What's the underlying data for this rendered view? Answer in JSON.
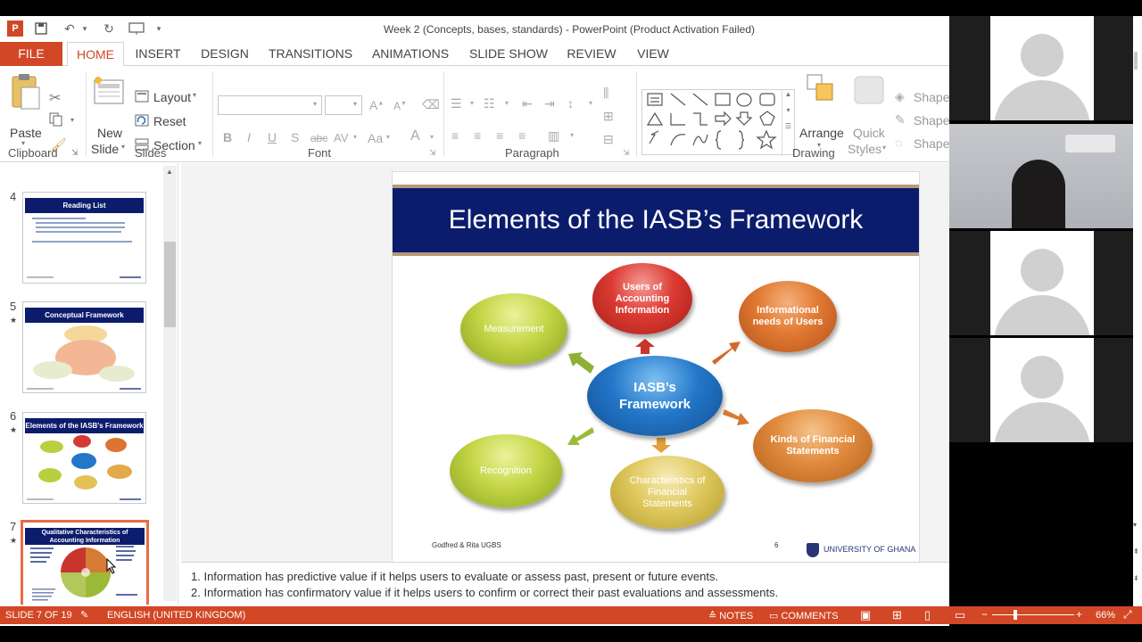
{
  "titlebar": {
    "title": "Week 2 (Concepts, bases, standards) - PowerPoint (Product Activation Failed)"
  },
  "tabs": [
    "FILE",
    "HOME",
    "INSERT",
    "DESIGN",
    "TRANSITIONS",
    "ANIMATIONS",
    "SLIDE SHOW",
    "REVIEW",
    "VIEW"
  ],
  "ribbon": {
    "clipboard": {
      "paste": "Paste",
      "label": "Clipboard"
    },
    "slides": {
      "new_slide_1": "New",
      "new_slide_2": "Slide",
      "layout": "Layout",
      "reset": "Reset",
      "section": "Section",
      "label": "Slides"
    },
    "font": {
      "label": "Font",
      "bold": "B",
      "italic": "I",
      "underline": "U",
      "shadow": "S",
      "strike": "abc",
      "spacing": "AV",
      "case": "Aa",
      "color": "A"
    },
    "paragraph": {
      "label": "Paragraph"
    },
    "drawing": {
      "label": "Drawing",
      "arrange": "Arrange",
      "quick_styles_1": "Quick",
      "quick_styles_2": "Styles",
      "shape_fill": "Shape",
      "shape_outline": "Shape",
      "shape_effects": "Shape"
    }
  },
  "thumbnails": [
    {
      "num": "4",
      "title": "Reading List",
      "star": ""
    },
    {
      "num": "5",
      "title": "Conceptual Framework",
      "star": "★"
    },
    {
      "num": "6",
      "title": "Elements of the IASB's Framework",
      "star": "★"
    },
    {
      "num": "7",
      "title": "Qualitative Characteristics of Accounting Information",
      "star": "★"
    }
  ],
  "slide": {
    "title": "Elements of the IASB’s Framework",
    "center": "IASB’s Framework",
    "nodes": {
      "users": "Users of Accounting Information",
      "needs": "Informational needs of Users",
      "measurement": "Measurement",
      "kinds": "Kinds of Financial Statements",
      "recognition": "Recognition",
      "characteristics": "Characteristics of Financial Statements"
    },
    "footer_left": "Godfred & Rita UGBS",
    "page_number": "6",
    "footer_right": "UNIVERSITY OF GHANA"
  },
  "notes": {
    "line1": "1.   Information has predictive value if it helps users to evaluate or assess past, present or future events.",
    "line2": "2.   Information has confirmatory value if it helps users to confirm or correct their past evaluations and assessments."
  },
  "status": {
    "slide": "SLIDE 7 OF 19",
    "language": "ENGLISH (UNITED KINGDOM)",
    "notes": "NOTES",
    "comments": "COMMENTS",
    "zoom": "66%"
  },
  "colors": {
    "accent": "#d24726",
    "slide_title_bg": "#0c1c6c"
  }
}
